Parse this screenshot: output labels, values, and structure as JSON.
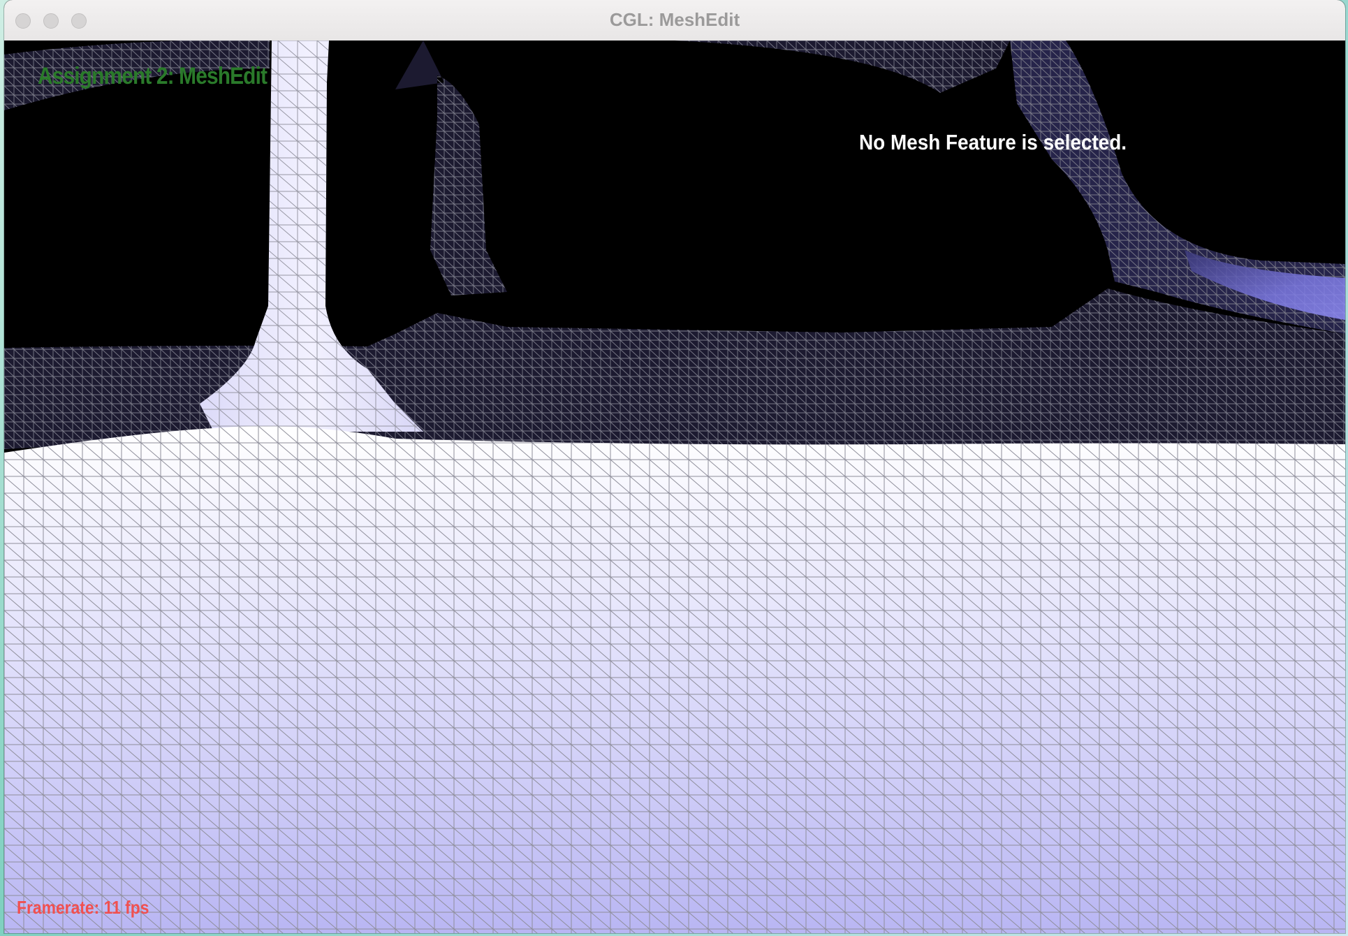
{
  "window": {
    "title": "CGL: MeshEdit"
  },
  "viewport": {
    "heading": "Assignment 2: MeshEdit",
    "status": "No Mesh Feature is selected.",
    "framerate": "Framerate: 11 fps"
  },
  "colors": {
    "heading": "#2a7a2a",
    "status": "#ffffff",
    "framerate": "#f05050",
    "background": "#000000",
    "surface_front": "#f4f3ff",
    "surface_shadow": "#b7b4f2",
    "surface_back": "#1c1a30",
    "wire": "#8e8e9a"
  },
  "icons": [
    "close-light-icon",
    "minimize-light-icon",
    "zoom-light-icon"
  ]
}
